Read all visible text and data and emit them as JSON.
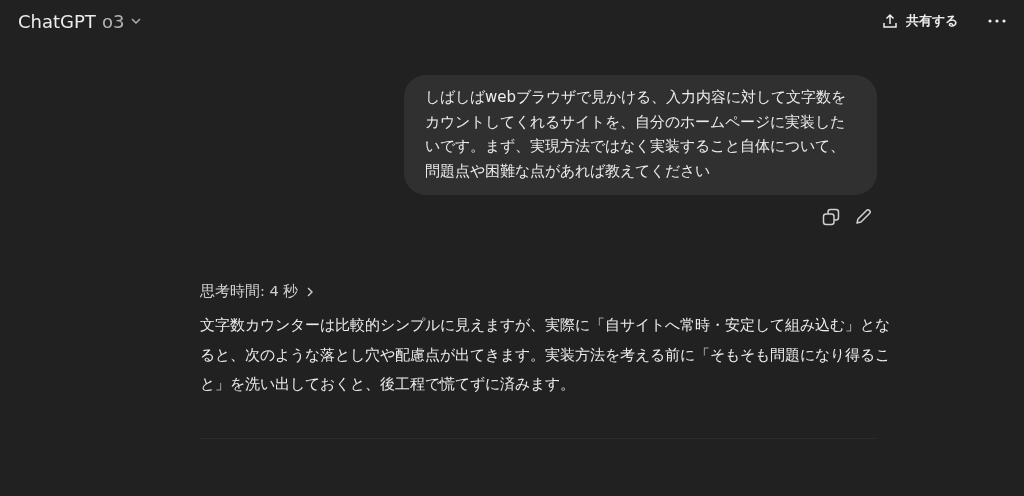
{
  "header": {
    "title": "ChatGPT",
    "model": "o3",
    "share_label": "共有する"
  },
  "user_message": {
    "text": "しばしばwebブラウザで見かける、入力内容に対して文字数をカウントしてくれるサイトを、自分のホームページに実装したいです。まず、実現方法ではなく実装すること自体について、問題点や困難な点があれば教えてください"
  },
  "assistant_message": {
    "thinking": "思考時間: 4 秒",
    "text": "文字数カウンターは比較的シンプルに見えますが、実際に「自サイトへ常時・安定して組み込む」となると、次のような落とし穴や配慮点が出てきます。実装方法を考える前に「そもそも問題になり得ること」を洗い出しておくと、後工程で慌てずに済みます。"
  }
}
